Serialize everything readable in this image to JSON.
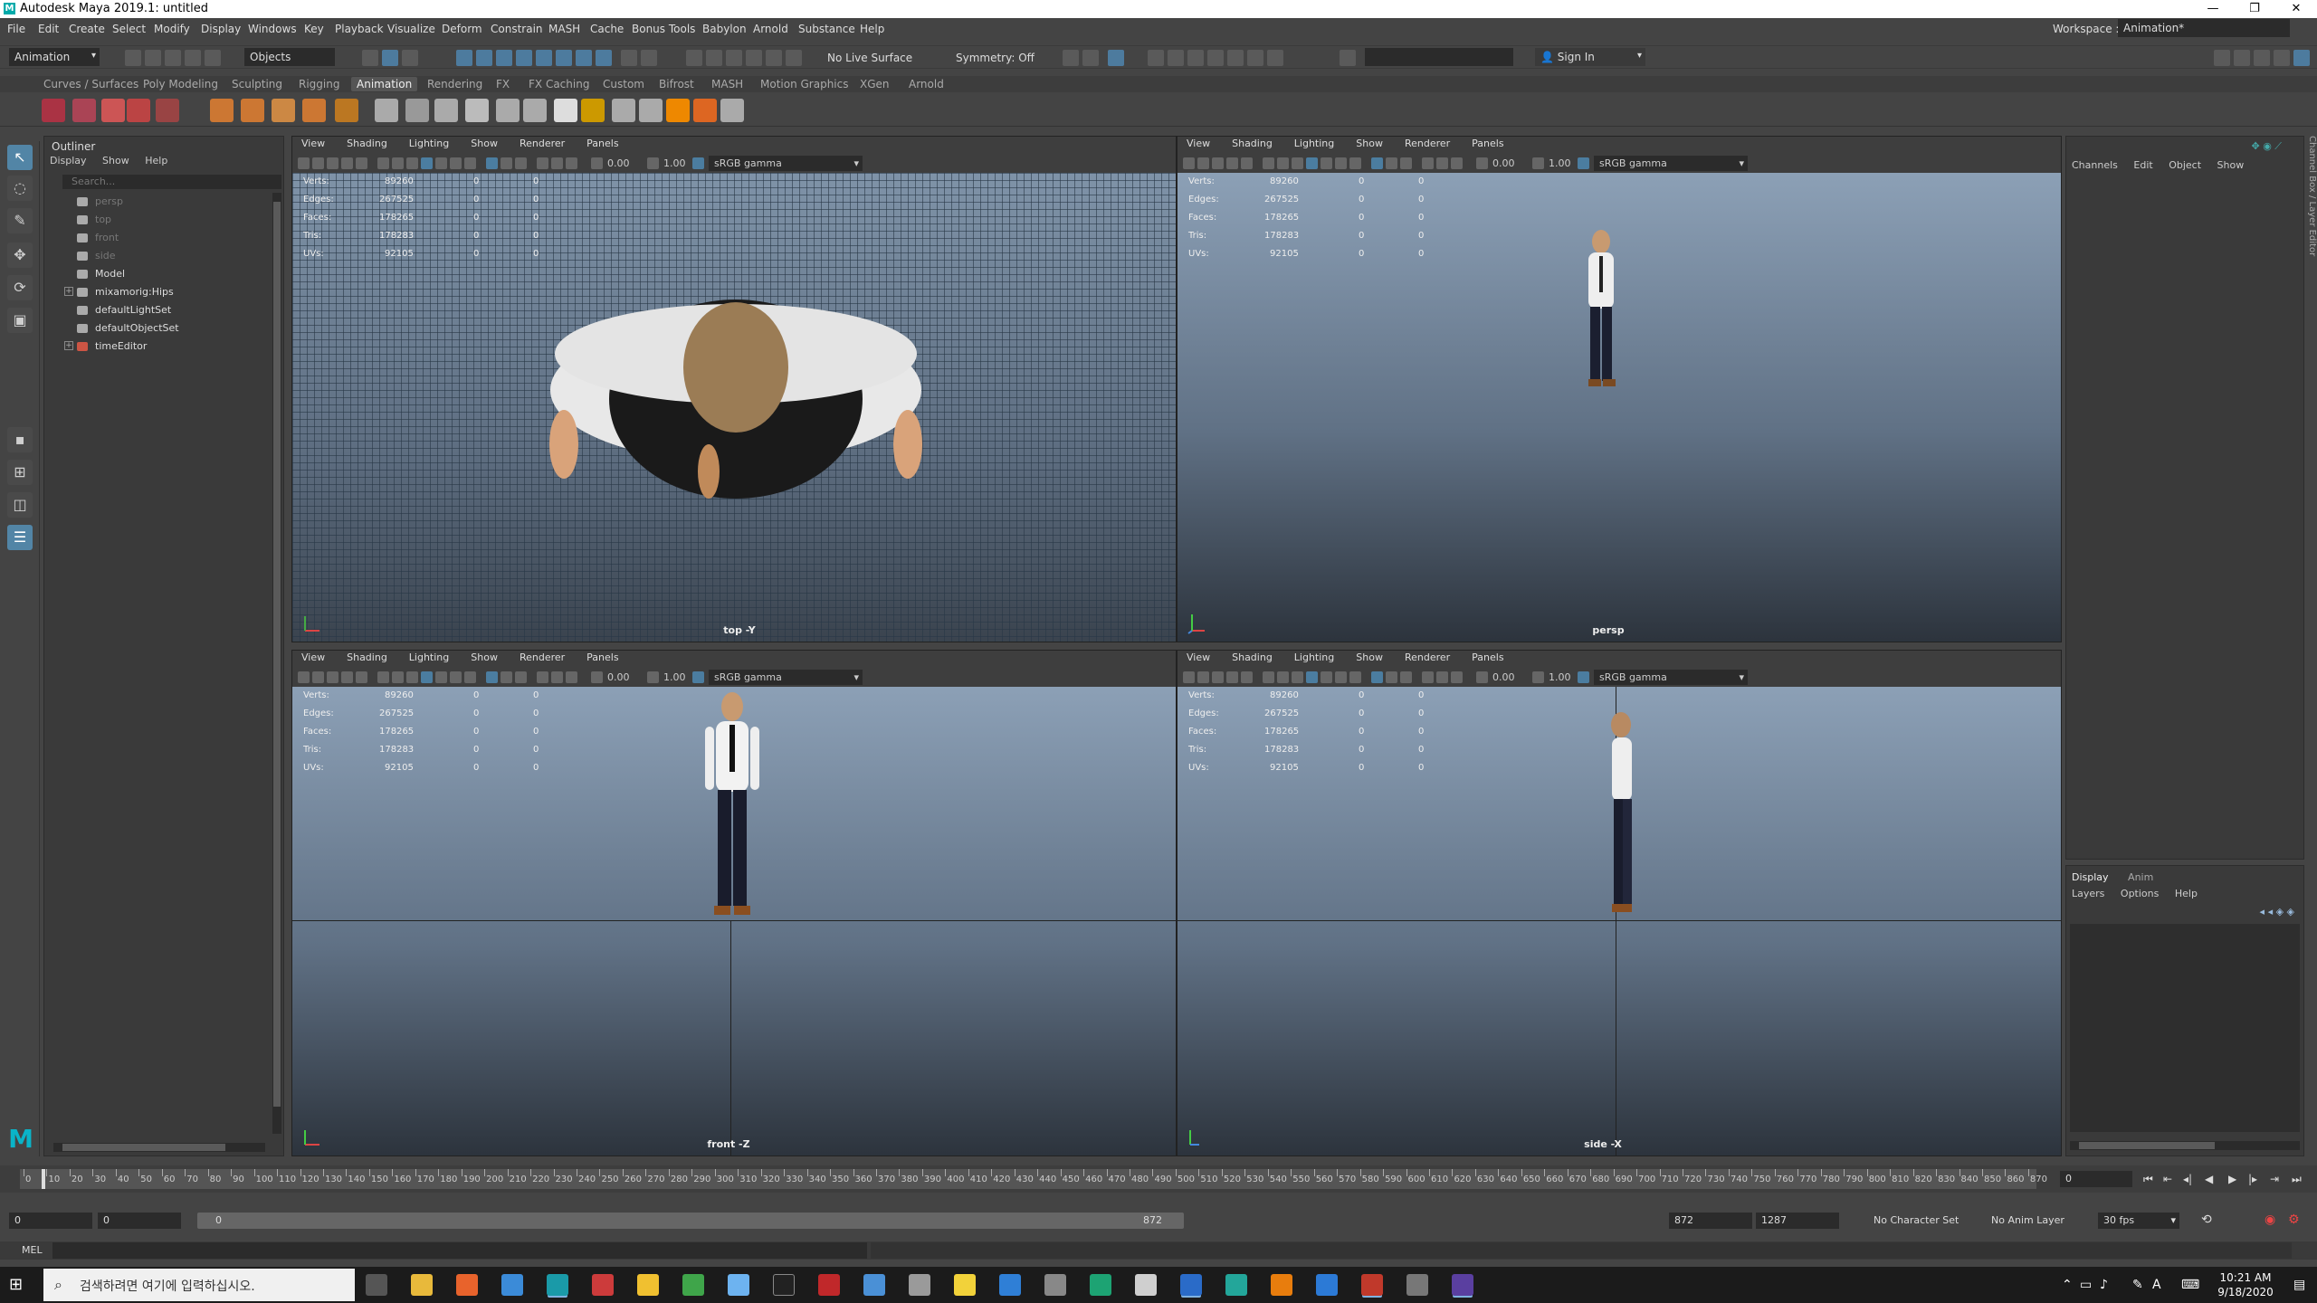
{
  "window": {
    "title": "Autodesk Maya 2019.1: untitled",
    "app_icon_label": "M",
    "minimize": "—",
    "maximize": "❐",
    "close": "✕"
  },
  "menubar": {
    "items": [
      "File",
      "Edit",
      "Create",
      "Select",
      "Modify",
      "Display",
      "Windows",
      "Key",
      "Playback",
      "Visualize",
      "Deform",
      "Constrain",
      "MASH",
      "Cache",
      "Bonus Tools",
      "Babylon",
      "Arnold",
      "Substance",
      "Help"
    ],
    "workspace_label": "Workspace :",
    "workspace_value": "Animation*"
  },
  "statusline": {
    "menuset": "Animation",
    "select_mode": "Objects",
    "live_surface": "No Live Surface",
    "symmetry": "Symmetry: Off",
    "sign_in": "Sign In"
  },
  "shelf": {
    "tabs": [
      "Curves / Surfaces",
      "Poly Modeling",
      "Sculpting",
      "Rigging",
      "Animation",
      "Rendering",
      "FX",
      "FX Caching",
      "Custom",
      "Bifrost",
      "MASH",
      "Motion Graphics",
      "XGen",
      "Arnold"
    ],
    "active_tab": "Animation"
  },
  "tools": [
    "select-tool",
    "lasso-tool",
    "paint-tool",
    "move-tool",
    "rotate-tool",
    "scale-tool"
  ],
  "outliner": {
    "title": "Outliner",
    "menu": [
      "Display",
      "Show",
      "Help"
    ],
    "search_placeholder": "Search...",
    "items": [
      {
        "label": "persp",
        "dim": true
      },
      {
        "label": "top",
        "dim": true
      },
      {
        "label": "front",
        "dim": true
      },
      {
        "label": "side",
        "dim": true
      },
      {
        "label": "Model",
        "dim": false
      },
      {
        "label": "mixamorig:Hips",
        "dim": false
      },
      {
        "label": "defaultLightSet",
        "dim": false
      },
      {
        "label": "defaultObjectSet",
        "dim": false
      },
      {
        "label": "timeEditor",
        "dim": false
      }
    ]
  },
  "viewport_menu": [
    "View",
    "Shading",
    "Lighting",
    "Show",
    "Renderer",
    "Panels"
  ],
  "viewport_toolbar": {
    "exposure": "0.00",
    "gamma": "1.00",
    "colorspace": "sRGB gamma"
  },
  "hud": [
    {
      "label": "Verts:",
      "value": "89260",
      "sel": "0",
      "sel2": "0"
    },
    {
      "label": "Edges:",
      "value": "267525",
      "sel": "0",
      "sel2": "0"
    },
    {
      "label": "Faces:",
      "value": "178265",
      "sel": "0",
      "sel2": "0"
    },
    {
      "label": "Tris:",
      "value": "178283",
      "sel": "0",
      "sel2": "0"
    },
    {
      "label": "UVs:",
      "value": "92105",
      "sel": "0",
      "sel2": "0"
    }
  ],
  "viewports": {
    "top": {
      "camera": "top -Y"
    },
    "persp": {
      "camera": "persp"
    },
    "front": {
      "camera": "front -Z"
    },
    "side": {
      "camera": "side -X"
    }
  },
  "channelbox": {
    "menu": [
      "Channels",
      "Edit",
      "Object",
      "Show"
    ]
  },
  "layer_editor": {
    "tabs": [
      "Display",
      "Anim"
    ],
    "menu": [
      "Layers",
      "Options",
      "Help"
    ]
  },
  "side_tabs": "Channel Box / Layer Editor",
  "timeslider": {
    "ticks": [
      "0",
      "10",
      "20",
      "30",
      "40",
      "50",
      "60",
      "70",
      "80",
      "90",
      "100",
      "110",
      "120",
      "130",
      "140",
      "150",
      "160",
      "170",
      "180",
      "190",
      "200",
      "210",
      "220",
      "230",
      "240",
      "250",
      "260",
      "270",
      "280",
      "290",
      "300",
      "310",
      "320",
      "330",
      "340",
      "350",
      "360",
      "370",
      "380",
      "390",
      "400",
      "410",
      "420",
      "430",
      "440",
      "450",
      "460",
      "470",
      "480",
      "490",
      "500",
      "510",
      "520",
      "530",
      "540",
      "550",
      "560",
      "570",
      "580",
      "590",
      "600",
      "610",
      "620",
      "630",
      "640",
      "650",
      "660",
      "670",
      "680",
      "690",
      "700",
      "710",
      "720",
      "730",
      "740",
      "750",
      "760",
      "770",
      "780",
      "790",
      "800",
      "810",
      "820",
      "830",
      "840",
      "850",
      "860",
      "870"
    ],
    "current_frame": "0",
    "playhead_label": "0"
  },
  "rangeslider": {
    "start": "0",
    "anim_start": "0",
    "range_start": "0",
    "range_end": "872",
    "end": "872",
    "anim_end": "1287",
    "character_set": "No Character Set",
    "anim_layer": "No Anim Layer",
    "fps": "30 fps"
  },
  "cmdline": {
    "label": "MEL"
  },
  "taskbar": {
    "search_placeholder": "검색하려면 여기에 입력하십시오.",
    "time": "10:21 AM",
    "date": "9/18/2020",
    "tray_lang": "A"
  }
}
